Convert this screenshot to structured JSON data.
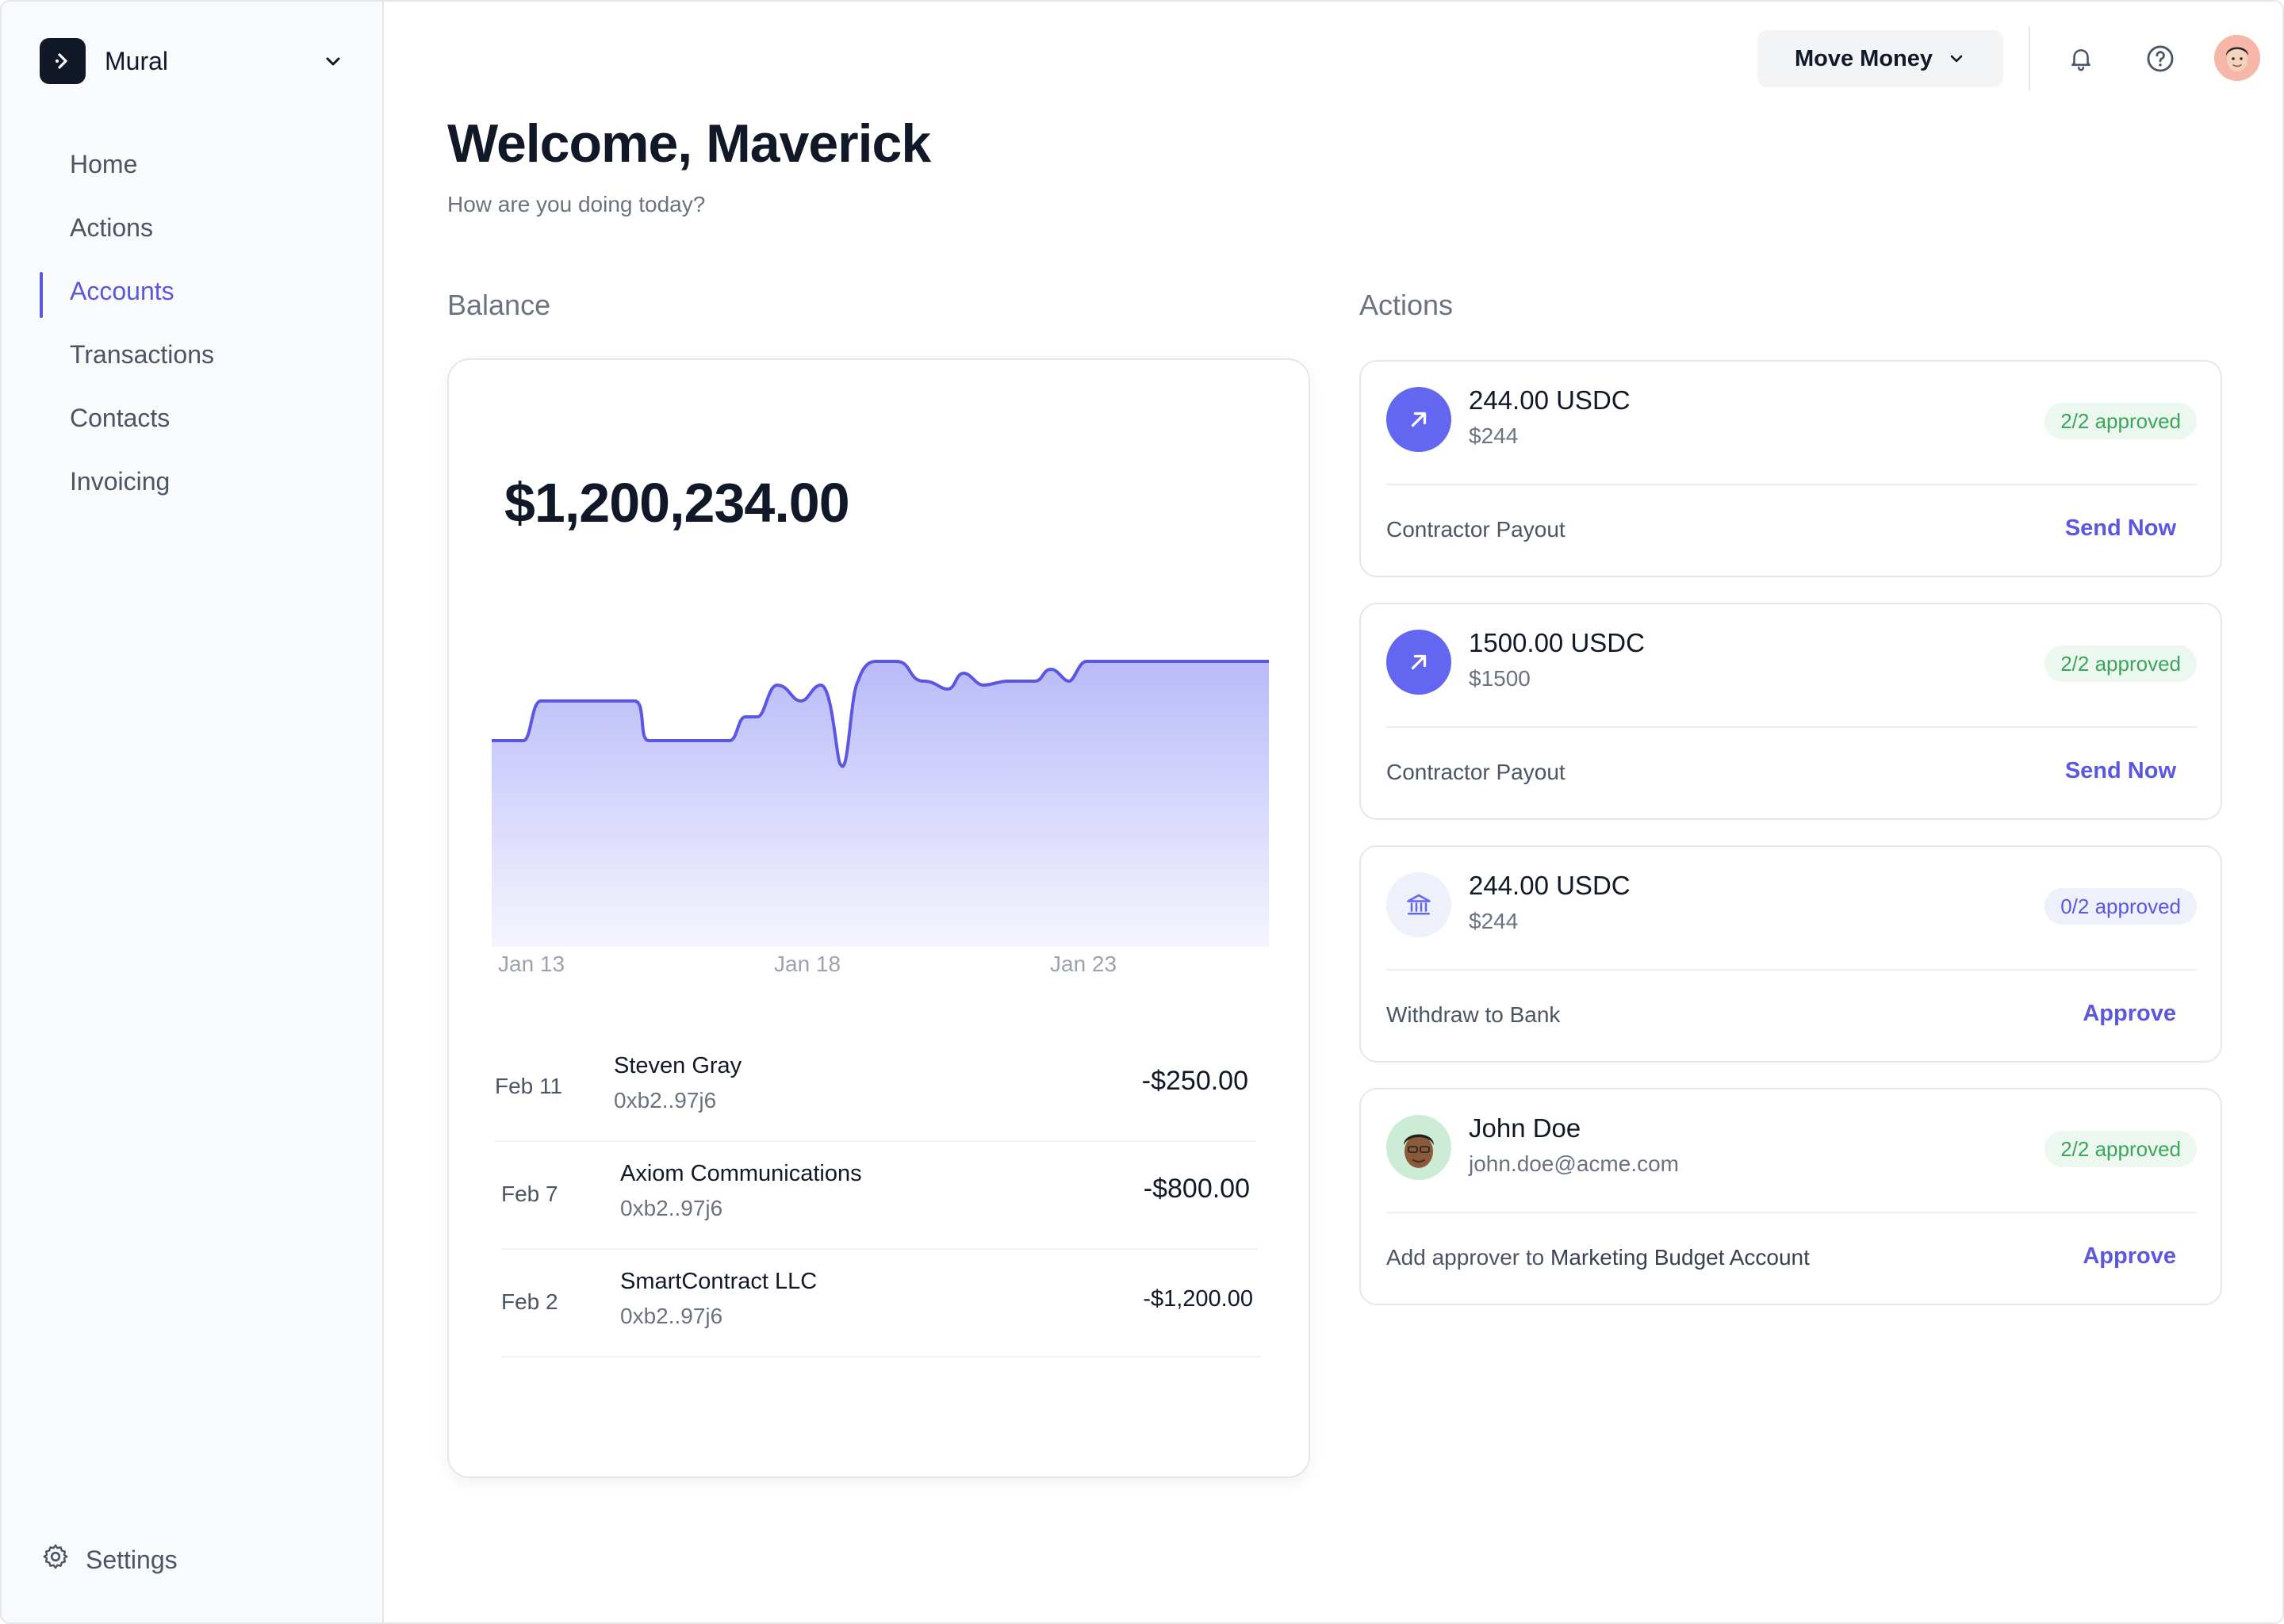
{
  "brand": {
    "name": "Mural",
    "logo_icon": "arrow-right-logo-icon",
    "chevron_icon": "chevron-down-icon"
  },
  "sidebar": {
    "items": [
      {
        "label": "Home",
        "active": false
      },
      {
        "label": "Actions",
        "active": false
      },
      {
        "label": "Accounts",
        "active": true
      },
      {
        "label": "Transactions",
        "active": false
      },
      {
        "label": "Contacts",
        "active": false
      },
      {
        "label": "Invoicing",
        "active": false
      }
    ],
    "settings_label": "Settings"
  },
  "topbar": {
    "move_money_label": "Move Money"
  },
  "main": {
    "title": "Welcome, Maverick",
    "subtitle": "How are you doing today?"
  },
  "balance": {
    "section_title": "Balance",
    "amount": "$1,200,234.00",
    "chart_data": {
      "type": "area",
      "x": [
        "Jan 13",
        "Jan 18",
        "Jan 23"
      ],
      "ticks": [
        "Jan 13",
        "Jan 18",
        "Jan 23"
      ],
      "color": "#6366f1"
    },
    "transactions": [
      {
        "date": "Feb 11",
        "name": "Steven Gray",
        "address": "0xb2..97j6",
        "amount": "-$250.00"
      },
      {
        "date": "Feb 7",
        "name": "Axiom Communications",
        "address": "0xb2..97j6",
        "amount": "-$800.00"
      },
      {
        "date": "Feb 2",
        "name": "SmartContract LLC",
        "address": "0xb2..97j6",
        "amount": "-$1,200.00"
      }
    ]
  },
  "actions": {
    "section_title": "Actions",
    "cards": [
      {
        "title": "244.00 USDC",
        "subtitle": "$244",
        "badge": "2/2 approved",
        "footer": "Contractor Payout",
        "footer_strong": "",
        "link": "Send Now"
      },
      {
        "title": "1500.00 USDC",
        "subtitle": "$1500",
        "badge": "2/2 approved",
        "footer": "Contractor Payout",
        "footer_strong": "",
        "link": "Send Now"
      },
      {
        "title": "244.00 USDC",
        "subtitle": "$244",
        "badge": "0/2 approved",
        "footer": "Withdraw to Bank",
        "footer_strong": "",
        "link": "Approve"
      },
      {
        "title": "John Doe",
        "subtitle": "john.doe@acme.com",
        "badge": "2/2 approved",
        "footer": "Add approver to ",
        "footer_strong": "Marketing Budget Account",
        "link": "Approve"
      }
    ]
  },
  "colors": {
    "accent": "#5b57e0",
    "approved_green": "#3ca55c",
    "chart": "#6366f1"
  }
}
